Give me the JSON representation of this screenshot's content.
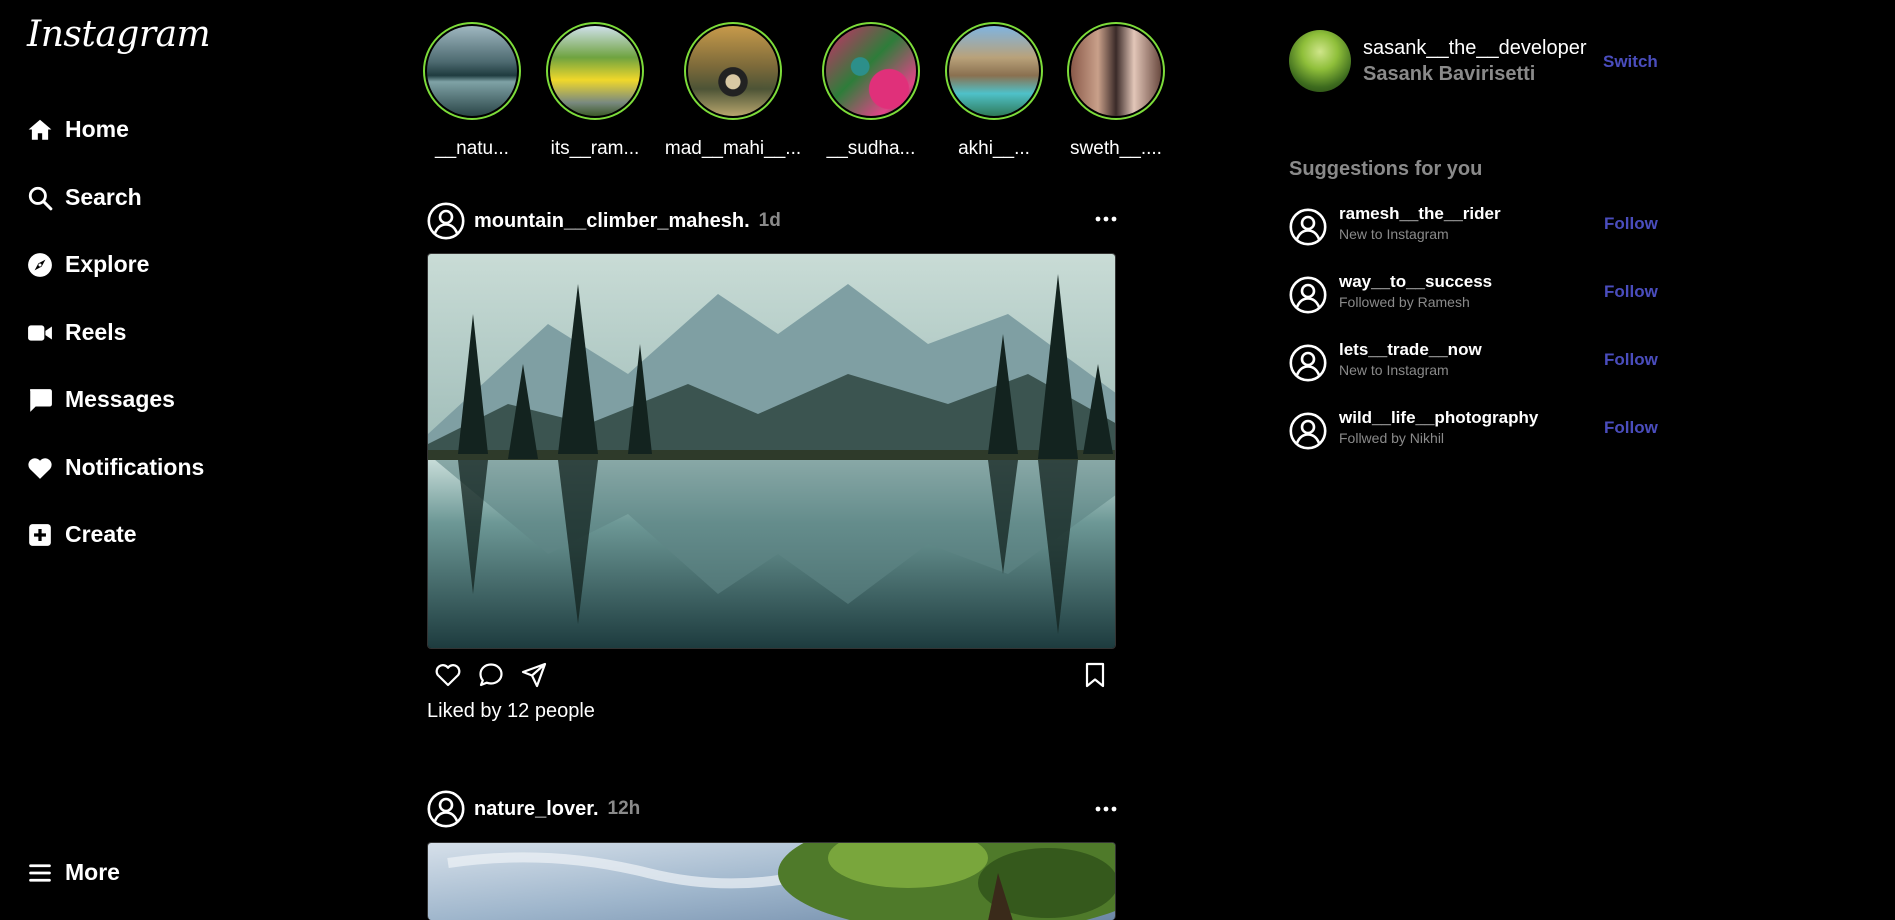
{
  "app": {
    "logo": "Instagram"
  },
  "nav": {
    "home": "Home",
    "search": "Search",
    "explore": "Explore",
    "reels": "Reels",
    "messages": "Messages",
    "notifications": "Notifications",
    "create": "Create",
    "more": "More"
  },
  "stories": [
    {
      "name": "__natu...",
      "icon": "story-thumbnail-lake"
    },
    {
      "name": "its__ram...",
      "icon": "story-thumbnail-road"
    },
    {
      "name": "mad__mahi__...",
      "icon": "story-thumbnail-bridge"
    },
    {
      "name": "__sudha...",
      "icon": "story-thumbnail-hummingbird"
    },
    {
      "name": "akhi__...",
      "icon": "story-thumbnail-waterfall"
    },
    {
      "name": "sweth__....",
      "icon": "story-thumbnail-camera"
    }
  ],
  "posts": [
    {
      "user": "mountain__climber_mahesh.",
      "time": "1d",
      "liked": "Liked by 12 people"
    },
    {
      "user": "nature_lover.",
      "time": "12h"
    }
  ],
  "profile": {
    "username": "sasank__the__developer",
    "name": "Sasank Bavirisetti",
    "switch": "Switch"
  },
  "suggestions": {
    "title": "Suggestions for you",
    "follow_label": "Follow",
    "items": [
      {
        "user": "ramesh__the__rider",
        "sub": "New to Instagram"
      },
      {
        "user": "way__to__success",
        "sub": "Followed by Ramesh"
      },
      {
        "user": "lets__trade__now",
        "sub": "New to Instagram"
      },
      {
        "user": "wild__life__photography",
        "sub": "Follwed by Nikhil"
      }
    ]
  },
  "colors": {
    "background": "#000000",
    "story_ring": "#7ddc3a",
    "link": "#4a4dbd",
    "muted": "#8a8a8a"
  }
}
